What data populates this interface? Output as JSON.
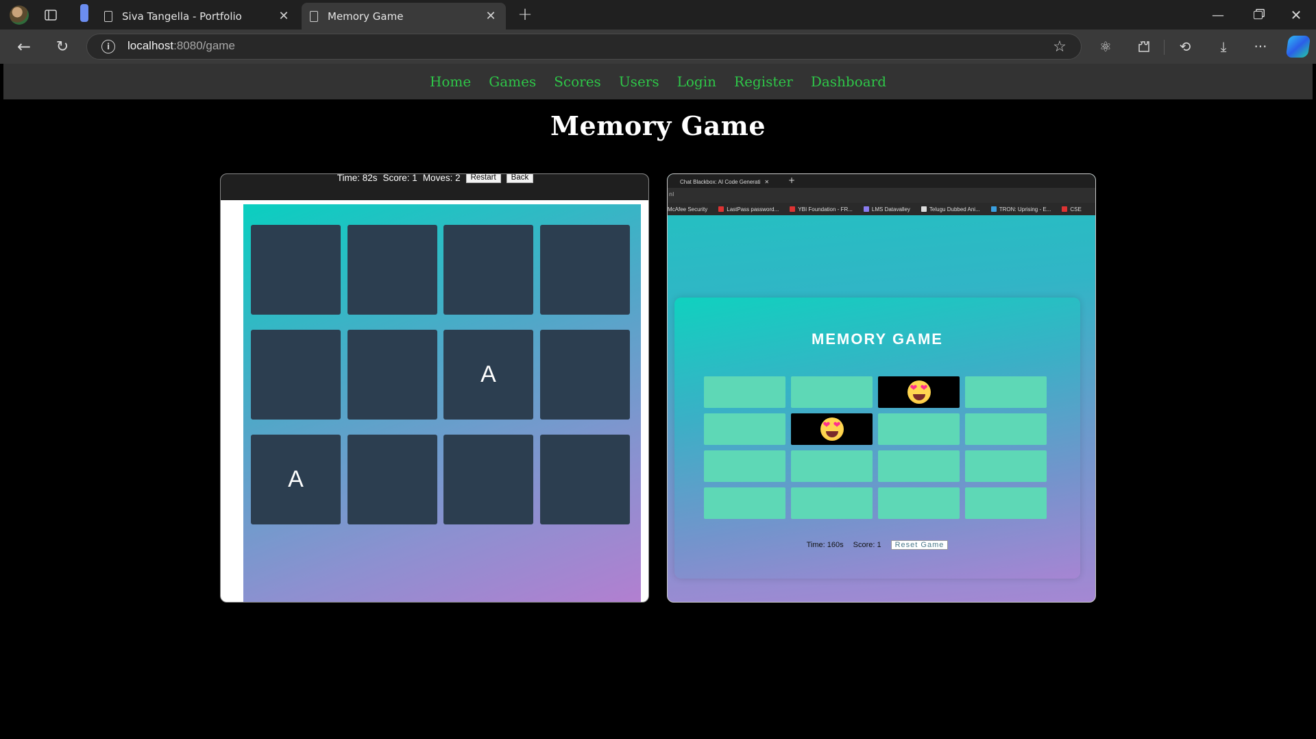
{
  "browser": {
    "tabs": [
      {
        "label": "Siva Tangella - Portfolio",
        "active": false
      },
      {
        "label": "Memory Game",
        "active": true
      }
    ],
    "url_host": "localhost",
    "url_path": ":8080/game",
    "icons": [
      "profile-avatar",
      "tab-actions-icon",
      "page-icon",
      "close-icon",
      "new-tab-icon",
      "back-icon",
      "reload-icon",
      "info-icon",
      "star-icon",
      "settings-icon",
      "extensions-icon",
      "history-icon",
      "download-icon",
      "more-icon",
      "copilot-icon"
    ]
  },
  "nav": {
    "items": [
      "Home",
      "Games",
      "Scores",
      "Users",
      "Login",
      "Register",
      "Dashboard"
    ],
    "color": "#2ec748"
  },
  "page_title": "Memory Game",
  "left_game": {
    "time": "Time: 82s",
    "score": "Score: 1",
    "moves": "Moves: 2",
    "restart_label": "Restart",
    "back_label": "Back",
    "cards": [
      [
        "",
        "",
        "",
        ""
      ],
      [
        "",
        "",
        "A",
        ""
      ],
      [
        "A",
        "",
        "",
        ""
      ]
    ],
    "card_color": "#2c3e50"
  },
  "right_screenshot": {
    "tab_label": "Chat Blackbox: AI Code Generati",
    "address_text": "nl",
    "bookmarks": [
      "McAfee Security",
      "LastPass password...",
      "YBI Foundation - FR...",
      "LMS Datavalley",
      "Telugu Dubbed Ani...",
      "TRON: Uprising - E...",
      "CSE"
    ],
    "title": "MEMORY GAME",
    "tiles": [
      [
        false,
        false,
        true,
        false
      ],
      [
        false,
        true,
        false,
        false
      ],
      [
        false,
        false,
        false,
        false
      ],
      [
        false,
        false,
        false,
        false
      ]
    ],
    "tile_color": "#5ed8b6",
    "time": "Time: 160s",
    "score": "Score: 1",
    "reset_label": "Reset Game"
  }
}
